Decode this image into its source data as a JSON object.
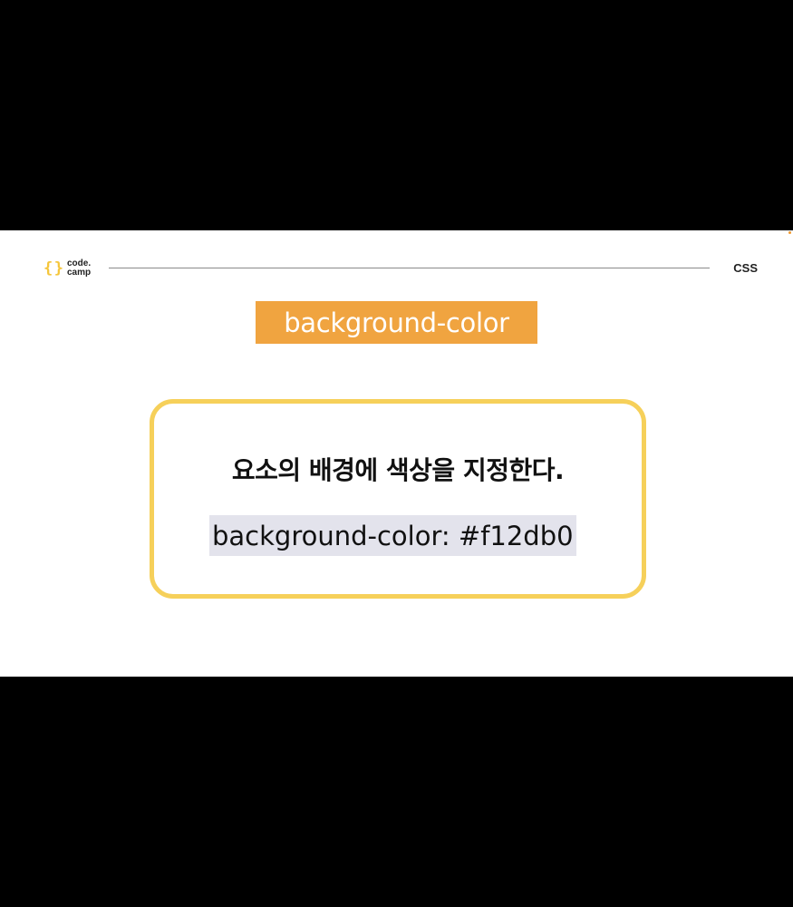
{
  "logo": {
    "brace_left": "{",
    "brace_right": "}",
    "line1": "code.",
    "line2": "camp"
  },
  "header": {
    "section_label": "CSS"
  },
  "slide": {
    "title": "background-color",
    "description": "요소의 배경에 색상을 지정한다.",
    "code": {
      "property": "background-color:",
      "value": "#f12db0"
    }
  },
  "colors": {
    "title_badge": "#f0a440",
    "card_border": "#f6d05a",
    "code_chip": "#e3e3ec",
    "logo_brace": "#f5c63b"
  }
}
